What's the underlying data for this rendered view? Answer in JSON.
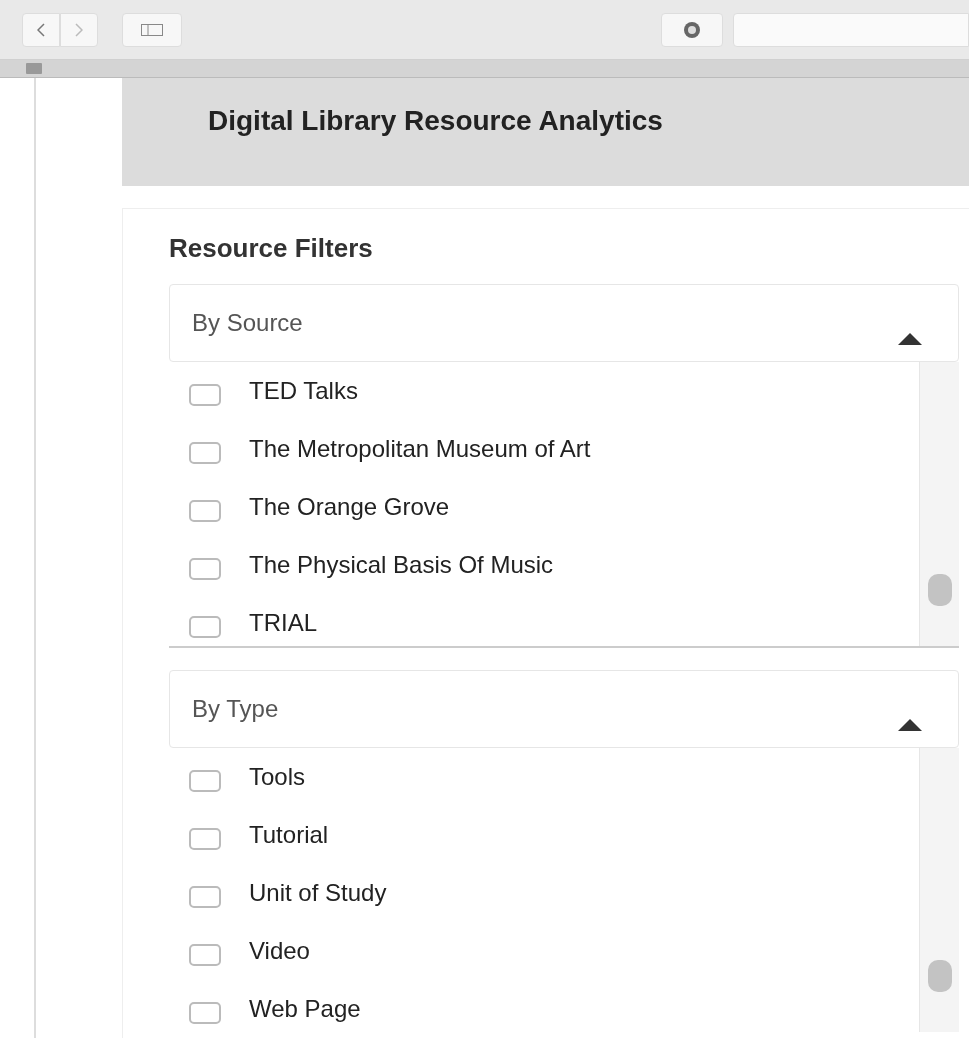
{
  "page": {
    "title": "Digital Library Resource Analytics"
  },
  "filters": {
    "title": "Resource Filters",
    "sections": [
      {
        "label": "By Source",
        "expanded": true,
        "items": [
          {
            "label": "TED Talks",
            "checked": false
          },
          {
            "label": "The Metropolitan Museum of Art",
            "checked": false
          },
          {
            "label": "The Orange Grove",
            "checked": false
          },
          {
            "label": "The Physical Basis Of Music",
            "checked": false
          },
          {
            "label": "TRIAL",
            "checked": false
          }
        ]
      },
      {
        "label": "By Type",
        "expanded": true,
        "items": [
          {
            "label": "Tools",
            "checked": false
          },
          {
            "label": "Tutorial",
            "checked": false
          },
          {
            "label": "Unit of Study",
            "checked": false
          },
          {
            "label": "Video",
            "checked": false
          },
          {
            "label": "Web Page",
            "checked": false
          }
        ]
      }
    ]
  }
}
